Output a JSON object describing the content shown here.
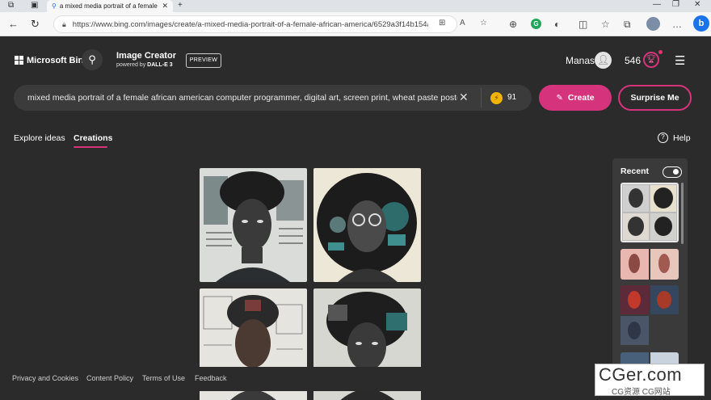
{
  "browser": {
    "tab_title": "a mixed media portrait of a female",
    "url": "https://www.bing.com/images/create/a-mixed-media-portrait-of-a-female-african-america/6529a3f14b154a..."
  },
  "header": {
    "brand": "Microsoft Bing",
    "product_title": "Image Creator",
    "powered_by": "powered by",
    "engine": "DALL-E 3",
    "preview_badge": "PREVIEW",
    "user_name": "Manas",
    "rewards_count": "546"
  },
  "prompt": {
    "value": "mixed media portrait of a female african american computer programmer, digital art, screen print, wheat paste poster",
    "boosts": "91",
    "create_label": "Create",
    "surprise_label": "Surprise Me"
  },
  "tabs": {
    "explore": "Explore ideas",
    "creations": "Creations",
    "help": "Help"
  },
  "recent": {
    "title": "Recent"
  },
  "footer": {
    "privacy": "Privacy and Cookies",
    "content_policy": "Content Policy",
    "terms": "Terms of Use",
    "feedback": "Feedback"
  },
  "watermark": {
    "big": "CGer.com",
    "small": "CG资源 CG网站"
  },
  "colors": {
    "accent": "#d6337d",
    "background": "#2b2b2b",
    "boost": "#f2b400"
  }
}
